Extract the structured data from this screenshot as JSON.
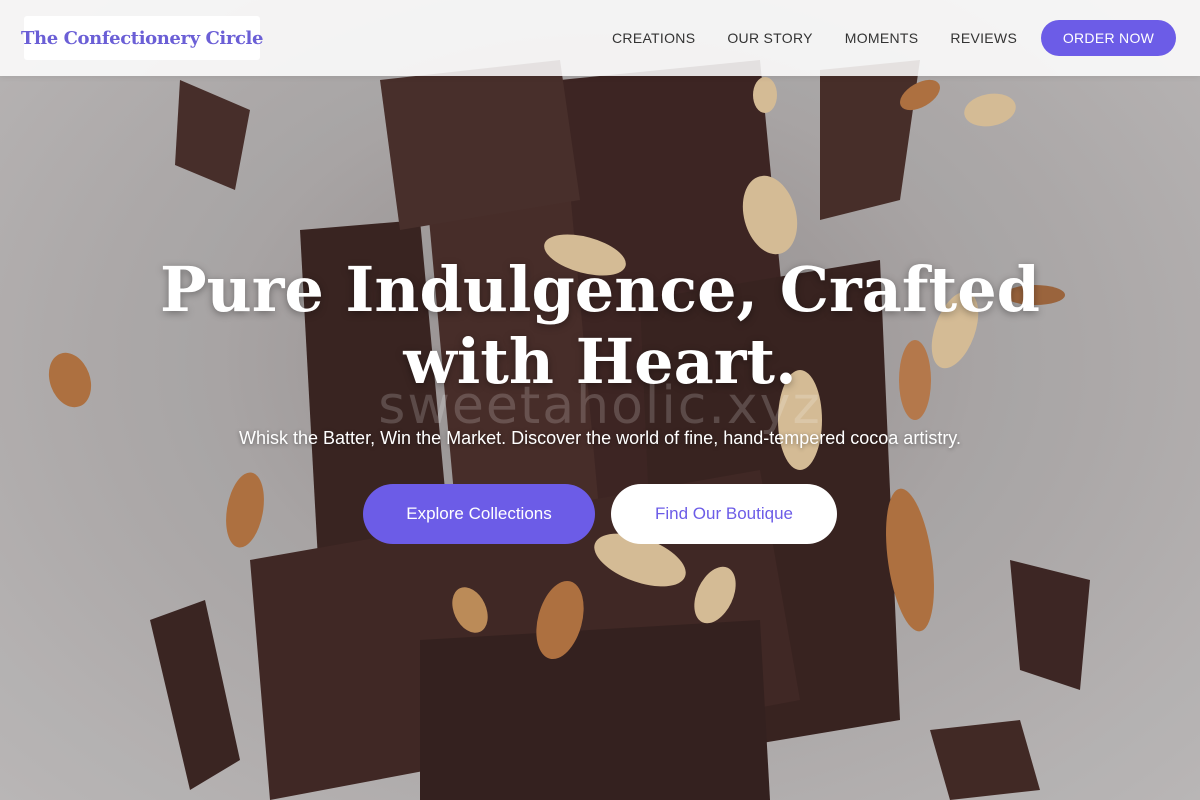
{
  "brand": {
    "logo_text": "The Confectionery Circle",
    "accent_color": "#6c5ce7"
  },
  "nav": {
    "items": [
      {
        "label": "CREATIONS"
      },
      {
        "label": "OUR STORY"
      },
      {
        "label": "MOMENTS"
      },
      {
        "label": "REVIEWS"
      }
    ],
    "cta_label": "ORDER NOW"
  },
  "hero": {
    "title_line1": "Pure Indulgence, Crafted",
    "title_line2": "with Heart.",
    "watermark": "sweetaholic.xyz",
    "subtitle": "Whisk the Batter, Win the Market. Discover the world of fine, hand-tempered cocoa artistry.",
    "primary_button": "Explore Collections",
    "secondary_button": "Find Our Boutique",
    "background": "chocolate-almond-photo"
  }
}
